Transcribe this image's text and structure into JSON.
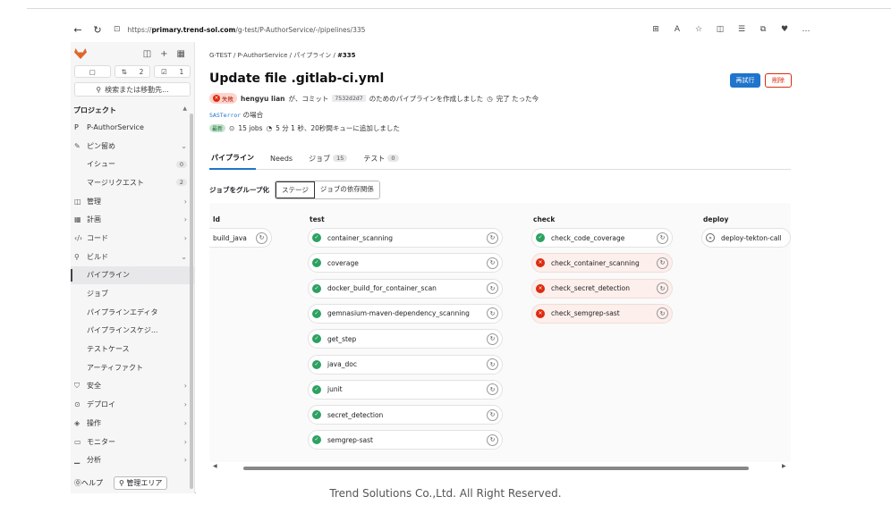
{
  "browser": {
    "url_host": "primary.trend-sol.com",
    "url_path": "/g-test/P-AuthorService/-/pipelines/335",
    "url_scheme": "https://",
    "icons": [
      "grid-icon",
      "read-aloud-icon",
      "star-icon",
      "split-icon",
      "favorites-icon",
      "collections-icon",
      "extensions-icon",
      "more-icon"
    ]
  },
  "sidebar": {
    "counts": [
      "2",
      "1"
    ],
    "search_label": "検索または移動先...",
    "section": "プロジェクト",
    "project_initial": "P",
    "project_name": "P-AuthorService",
    "pinned": "ピン留め",
    "pinned_items": [
      {
        "label": "イシュー",
        "count": "0"
      },
      {
        "label": "マージリクエスト",
        "count": "2"
      }
    ],
    "menu": [
      {
        "label": "管理",
        "icon": "◫"
      },
      {
        "label": "計画",
        "icon": "▦"
      },
      {
        "label": "コード",
        "icon": "‹/›"
      },
      {
        "label": "ビルド",
        "icon": "⚲"
      }
    ],
    "build_items": [
      "パイプライン",
      "ジョブ",
      "パイプラインエディタ",
      "パイプラインスケジ...",
      "テストケース",
      "アーティファクト"
    ],
    "menu2": [
      {
        "label": "安全",
        "icon": "⛉"
      },
      {
        "label": "デプロイ",
        "icon": "⊙"
      },
      {
        "label": "操作",
        "icon": "◈"
      },
      {
        "label": "モニター",
        "icon": "▭"
      },
      {
        "label": "分析",
        "icon": "▁"
      }
    ],
    "help": "ヘルプ",
    "admin": "管理エリア"
  },
  "header": {
    "breadcrumb": [
      "G-TEST",
      "P-AuthorService",
      "パイプライン",
      "#335"
    ],
    "title": "Update file .gitlab-ci.yml",
    "retry_label": "再試行",
    "delete_label": "削除",
    "status": "失敗",
    "author": "hengyu lian",
    "commit_text_1": "が、コミット",
    "sha": "7532d2d7",
    "commit_text_2": "のためのパイプラインを作成しました",
    "finished": "完了 たった今",
    "ref": "SASTerror",
    "ref_suffix": "の場合",
    "latest": "最新",
    "jobs": "15 jobs",
    "duration": "5 分 1 秒、20秒間キューに追加しました"
  },
  "tabs": [
    {
      "label": "パイプライン",
      "count": ""
    },
    {
      "label": "Needs",
      "count": ""
    },
    {
      "label": "ジョブ",
      "count": "15"
    },
    {
      "label": "テスト",
      "count": "0"
    }
  ],
  "grouping": {
    "label": "ジョブをグループ化",
    "options": [
      "ステージ",
      "ジョブの依存関係"
    ]
  },
  "stages": [
    {
      "name": "ld",
      "jobs": [
        {
          "name": "build_java",
          "status": "partial"
        }
      ]
    },
    {
      "name": "test",
      "jobs": [
        {
          "name": "container_scanning",
          "status": "success"
        },
        {
          "name": "coverage",
          "status": "success"
        },
        {
          "name": "docker_build_for_container_scan",
          "status": "success"
        },
        {
          "name": "gemnasium-maven-dependency_scanning",
          "status": "success"
        },
        {
          "name": "get_step",
          "status": "success"
        },
        {
          "name": "java_doc",
          "status": "success"
        },
        {
          "name": "junit",
          "status": "success"
        },
        {
          "name": "secret_detection",
          "status": "success"
        },
        {
          "name": "semgrep-sast",
          "status": "success"
        }
      ]
    },
    {
      "name": "check",
      "jobs": [
        {
          "name": "check_code_coverage",
          "status": "success"
        },
        {
          "name": "check_container_scanning",
          "status": "failed"
        },
        {
          "name": "check_secret_detection",
          "status": "failed"
        },
        {
          "name": "check_semgrep-sast",
          "status": "failed"
        }
      ]
    },
    {
      "name": "deploy",
      "jobs": [
        {
          "name": "deploy-tekton-call",
          "status": "manual"
        }
      ]
    }
  ],
  "footer": "Trend Solutions Co.,Ltd. All Right Reserved."
}
